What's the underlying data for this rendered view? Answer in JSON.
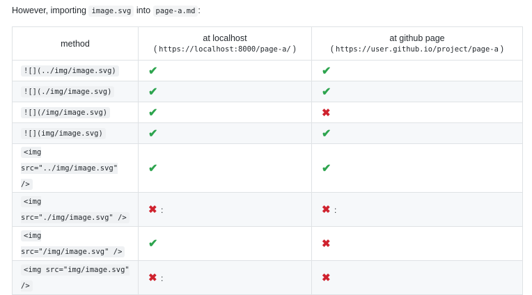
{
  "intro": {
    "prefix": "However, importing",
    "code1": "image.svg",
    "middle": "into",
    "code2": "page-a.md",
    "suffix": ":"
  },
  "table": {
    "headers": {
      "method": "method",
      "localhost": "at localhost",
      "localhost_open": "( ",
      "localhost_url": "https://localhost:8000/page-a/",
      "localhost_close": " )",
      "github": "at github page",
      "github_open": "( ",
      "github_url": "https://user.github.io/project/page-a",
      "github_close": " )"
    },
    "rows": [
      {
        "method": "![](../img/image.svg)",
        "localhost": "ok",
        "localhost_note": "",
        "github": "ok",
        "github_note": ""
      },
      {
        "method": "![](./img/image.svg)",
        "localhost": "ok",
        "localhost_note": "",
        "github": "ok",
        "github_note": ""
      },
      {
        "method": "![](/img/image.svg)",
        "localhost": "ok",
        "localhost_note": "",
        "github": "fail",
        "github_note": ""
      },
      {
        "method": "![](img/image.svg)",
        "localhost": "ok",
        "localhost_note": "",
        "github": "ok",
        "github_note": ""
      },
      {
        "method": "<img src=\"../img/image.svg\" />",
        "localhost": "ok",
        "localhost_note": "",
        "github": "ok",
        "github_note": ""
      },
      {
        "method": "<img src=\"./img/image.svg\" />",
        "localhost": "fail",
        "localhost_note": ":",
        "github": "fail",
        "github_note": ":"
      },
      {
        "method": "<img src=\"/img/image.svg\" />",
        "localhost": "ok",
        "localhost_note": "",
        "github": "fail",
        "github_note": ""
      },
      {
        "method": "<img src=\"img/image.svg\" />",
        "localhost": "fail",
        "localhost_note": ":",
        "github": "fail",
        "github_note": ""
      }
    ]
  },
  "icons": {
    "ok": "heavy-check-mark-icon",
    "fail": "heavy-multiplication-x-icon"
  },
  "colors": {
    "ok": "#2da44e",
    "fail": "#cf222e",
    "border": "#dfe2e5",
    "stripe": "#f6f8fa"
  }
}
